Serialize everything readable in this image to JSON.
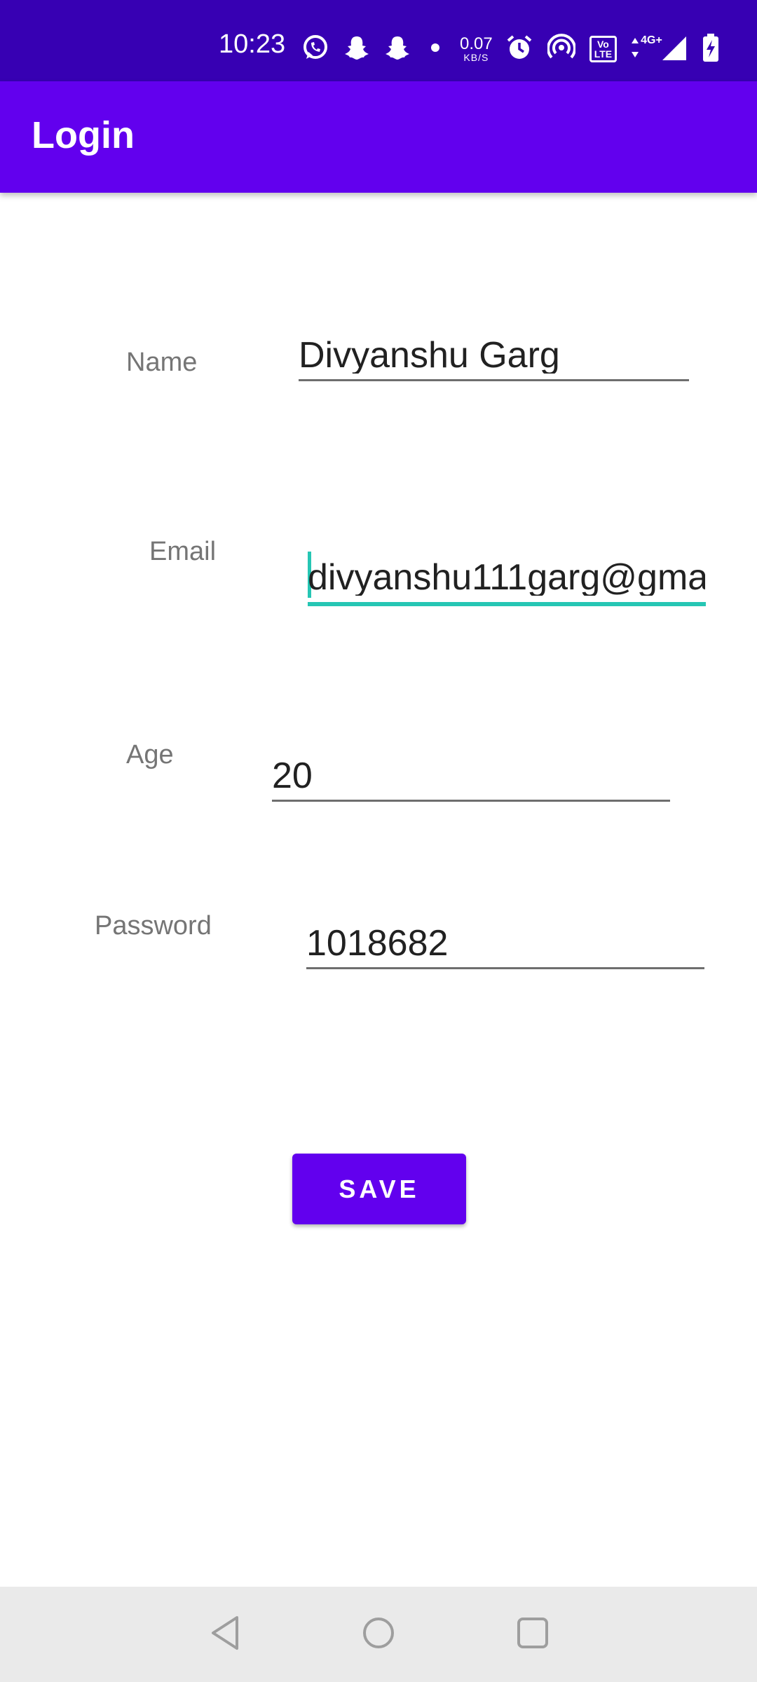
{
  "status_bar": {
    "time": "10:23",
    "net_speed_value": "0.07",
    "net_speed_unit": "KB/S",
    "volte_line1": "Vo",
    "volte_line2": "LTE",
    "network_type": "4G+",
    "icons": [
      "whatsapp-icon",
      "snapchat-icon",
      "snapchat-icon",
      "dot-icon",
      "alarm-icon",
      "hotspot-icon",
      "volte-icon",
      "data-arrows-icon",
      "signal-icon",
      "battery-charging-icon"
    ]
  },
  "app_bar": {
    "title": "Login"
  },
  "form": {
    "name_label": "Name",
    "name_value": "Divyanshu Garg",
    "email_label": "Email",
    "email_value": "divyanshu111garg@gma",
    "age_label": "Age",
    "age_value": "20",
    "password_label": "Password",
    "password_value": "1018682"
  },
  "save_button": {
    "label": "SAVE"
  },
  "colors": {
    "status_bar": "#3700b3",
    "primary": "#6200ee",
    "focus_accent": "#26c6b4"
  },
  "nav_bar": {
    "icons": [
      "back-icon",
      "home-icon",
      "recents-icon"
    ]
  }
}
